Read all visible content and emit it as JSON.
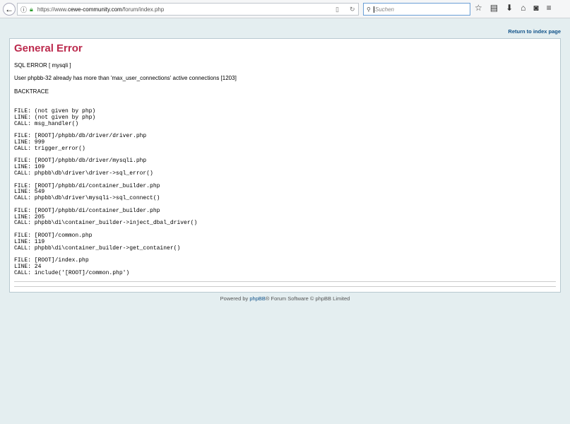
{
  "browser": {
    "url_prefix": "https://www.",
    "url_host": "cewe-community.com",
    "url_path": "/forum/index.php",
    "search_placeholder": "Suchen"
  },
  "header": {
    "return_link": "Return to index page"
  },
  "error": {
    "title": "General Error",
    "sql_error": "SQL ERROR [ mysqli ]",
    "message": "User phpbb-32 already has more than 'max_user_connections' active connections [1203]",
    "backtrace_label": "BACKTRACE",
    "trace": [
      {
        "file": "FILE: (not given by php)",
        "line": "LINE: (not given by php)",
        "call": "CALL: msg_handler()"
      },
      {
        "file": "FILE: [ROOT]/phpbb/db/driver/driver.php",
        "line": "LINE: 999",
        "call": "CALL: trigger_error()"
      },
      {
        "file": "FILE: [ROOT]/phpbb/db/driver/mysqli.php",
        "line": "LINE: 109",
        "call": "CALL: phpbb\\db\\driver\\driver->sql_error()"
      },
      {
        "file": "FILE: [ROOT]/phpbb/di/container_builder.php",
        "line": "LINE: 549",
        "call": "CALL: phpbb\\db\\driver\\mysqli->sql_connect()"
      },
      {
        "file": "FILE: [ROOT]/phpbb/di/container_builder.php",
        "line": "LINE: 205",
        "call": "CALL: phpbb\\di\\container_builder->inject_dbal_driver()"
      },
      {
        "file": "FILE: [ROOT]/common.php",
        "line": "LINE: 119",
        "call": "CALL: phpbb\\di\\container_builder->get_container()"
      },
      {
        "file": "FILE: [ROOT]/index.php",
        "line": "LINE: 24",
        "call": "CALL: include('[ROOT]/common.php')"
      }
    ]
  },
  "footer": {
    "powered_by": "Powered by ",
    "phpbb_link": "phpBB",
    "rest": "® Forum Software © phpBB Limited"
  }
}
